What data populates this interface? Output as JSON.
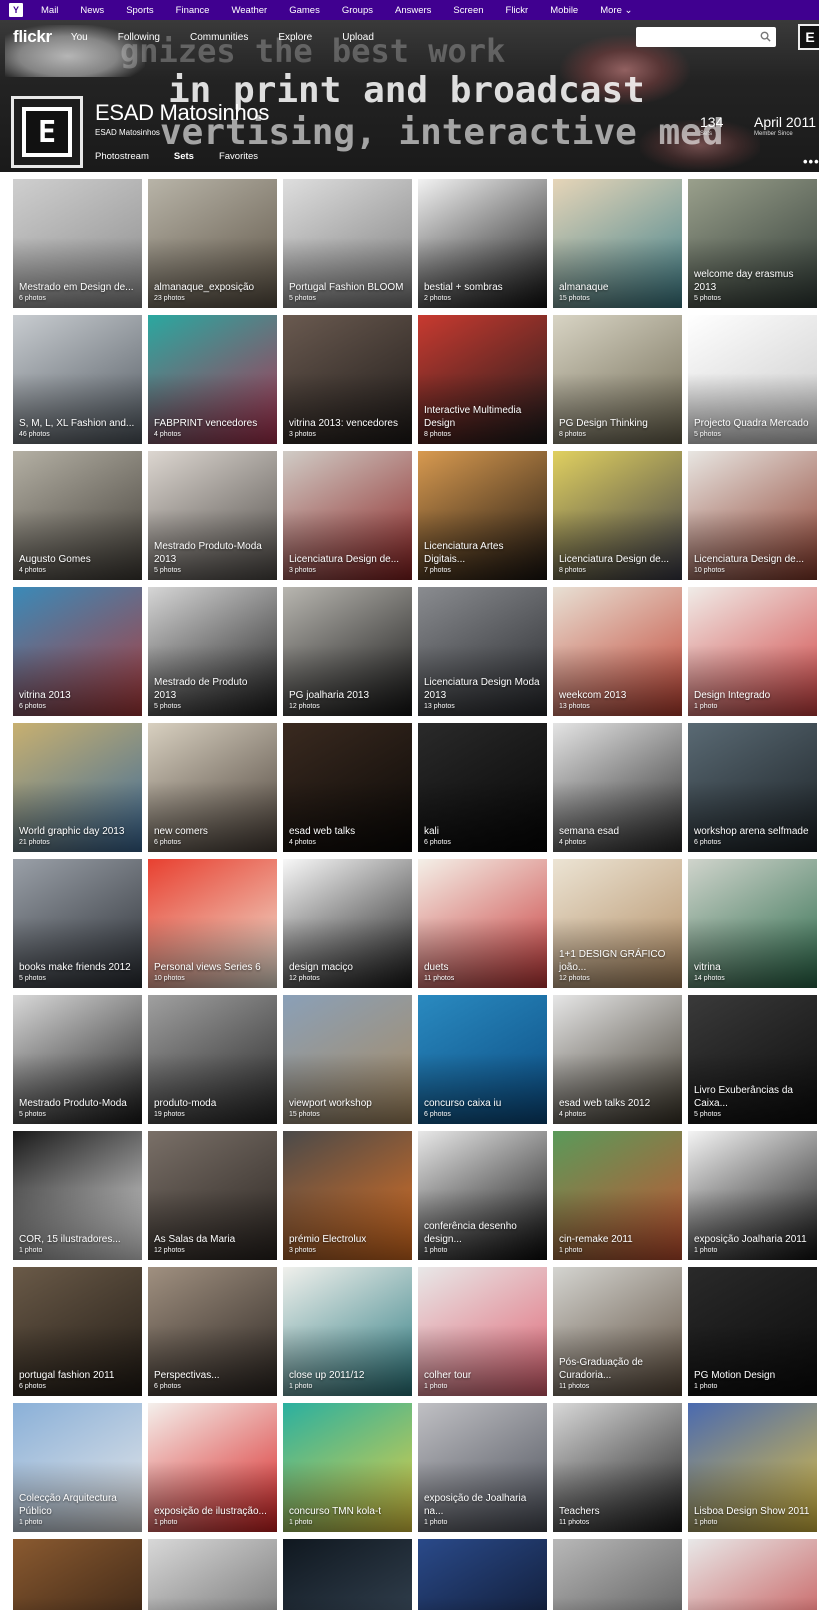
{
  "yahoo_bar": {
    "logo": "Y",
    "links": [
      "Mail",
      "News",
      "Sports",
      "Finance",
      "Weather",
      "Games",
      "Groups",
      "Answers",
      "Screen",
      "Flickr",
      "Mobile",
      "More ⌄"
    ]
  },
  "nav": {
    "logo": "flickr",
    "links": [
      "You",
      "Following",
      "Communities",
      "Explore",
      "Upload"
    ],
    "search_placeholder": "",
    "avatar_glyph": "E"
  },
  "banner": {
    "line1": "gnizes the best work",
    "line2": "in print and broadcast",
    "line3": "vertising, interactive med"
  },
  "profile": {
    "name": "ESAD Matosinhos",
    "subname": "ESAD Matosinhos",
    "avatar_glyph": "E",
    "sets_count": "134",
    "sets_label": "Sets",
    "member_since": "April 2011",
    "member_since_label": "Member Since"
  },
  "tabs": [
    "Photostream",
    "Sets",
    "Favorites"
  ],
  "active_tab": "Sets",
  "more_label": "•••",
  "sets": [
    {
      "title": "Mestrado em Design de...",
      "count": "6 photos",
      "bg": "#cfcfcf",
      "bg2": "#8a8a8a"
    },
    {
      "title": "almanaque_exposição",
      "count": "23 photos",
      "bg": "#b8b4a8",
      "bg2": "#5c5244"
    },
    {
      "title": "Portugal Fashion BLOOM",
      "count": "5 photos",
      "bg": "#dedede",
      "bg2": "#7a7a7a"
    },
    {
      "title": "bestial + sombras",
      "count": "2 photos",
      "bg": "#f2f2f2",
      "bg2": "#111111"
    },
    {
      "title": "almanaque",
      "count": "15 photos",
      "bg": "#e6d5b8",
      "bg2": "#3d7f8a"
    },
    {
      "title": "welcome day erasmus 2013",
      "count": "5 photos",
      "bg": "#9aa08c",
      "bg2": "#2f3a35"
    },
    {
      "title": "S, M, L, XL Fashion and...",
      "count": "46 photos",
      "bg": "#c8ccd0",
      "bg2": "#505860"
    },
    {
      "title": "FABPRINT vencedores",
      "count": "4 photos",
      "bg": "#2aa8a0",
      "bg2": "#b03050"
    },
    {
      "title": "vitrina 2013: vencedores",
      "count": "3 photos",
      "bg": "#6a5a50",
      "bg2": "#1e1a18"
    },
    {
      "title": "Interactive Multimedia Design",
      "count": "8 photos",
      "bg": "#c83a30",
      "bg2": "#1b1b1b"
    },
    {
      "title": "PG Design Thinking",
      "count": "8 photos",
      "bg": "#d8d4c4",
      "bg2": "#6c6650"
    },
    {
      "title": "Projecto Quadra Mercado",
      "count": "5 photos",
      "bg": "#ffffff",
      "bg2": "#c8c8c8"
    },
    {
      "title": "Augusto Gomes",
      "count": "4 photos",
      "bg": "#b4b0a4",
      "bg2": "#403c36"
    },
    {
      "title": "Mestrado Produto-Moda 2013",
      "count": "5 photos",
      "bg": "#dcd6d0",
      "bg2": "#4e4a46"
    },
    {
      "title": "Licenciatura Design de...",
      "count": "3 photos",
      "bg": "#d0ccc6",
      "bg2": "#8a2020"
    },
    {
      "title": "Licenciatura Artes Digitais...",
      "count": "7 photos",
      "bg": "#d89a50",
      "bg2": "#1a1410"
    },
    {
      "title": "Licenciatura Design de...",
      "count": "8 photos",
      "bg": "#e0d060",
      "bg2": "#3a3a48"
    },
    {
      "title": "Licenciatura Design de...",
      "count": "10 photos",
      "bg": "#e8e6e2",
      "bg2": "#8a3a2a"
    },
    {
      "title": "vitrina 2013",
      "count": "6 photos",
      "bg": "#3a8ab8",
      "bg2": "#b03a3a"
    },
    {
      "title": "Mestrado de Produto 2013",
      "count": "5 photos",
      "bg": "#d6d6d6",
      "bg2": "#1c1c1c"
    },
    {
      "title": "PG joalharia 2013",
      "count": "12 photos",
      "bg": "#b8b6b0",
      "bg2": "#141414"
    },
    {
      "title": "Licenciatura Design Moda 2013",
      "count": "13 photos",
      "bg": "#8a8c90",
      "bg2": "#26282c"
    },
    {
      "title": "weekcom 2013",
      "count": "13 photos",
      "bg": "#e8e0d4",
      "bg2": "#c04030"
    },
    {
      "title": "Design Integrado",
      "count": "1 photo",
      "bg": "#f0ece8",
      "bg2": "#d04040"
    },
    {
      "title": "World graphic day 2013",
      "count": "21 photos",
      "bg": "#c8b070",
      "bg2": "#3a6a9a"
    },
    {
      "title": "new comers",
      "count": "6 photos",
      "bg": "#d8d0c0",
      "bg2": "#4a4038"
    },
    {
      "title": "esad web talks",
      "count": "4 photos",
      "bg": "#3a2a20",
      "bg2": "#0a0806"
    },
    {
      "title": "kali",
      "count": "6 photos",
      "bg": "#2a2a2a",
      "bg2": "#050505"
    },
    {
      "title": "semana esad",
      "count": "4 photos",
      "bg": "#e4e4e4",
      "bg2": "#2a2a2a"
    },
    {
      "title": "workshop arena selfmade",
      "count": "6 photos",
      "bg": "#5a6a74",
      "bg2": "#1a2024"
    },
    {
      "title": "books make friends 2012",
      "count": "5 photos",
      "bg": "#9aa0a8",
      "bg2": "#2a2e34"
    },
    {
      "title": "Personal views Series 6",
      "count": "10 photos",
      "bg": "#e84030",
      "bg2": "#f0e8d8"
    },
    {
      "title": "design maciço",
      "count": "12 photos",
      "bg": "#f8f8f8",
      "bg2": "#1a1a1a"
    },
    {
      "title": "duets",
      "count": "11 photos",
      "bg": "#f4f0e8",
      "bg2": "#c83838"
    },
    {
      "title": "1+1 DESIGN GRÁFICO joão...",
      "count": "12 photos",
      "bg": "#ece4d4",
      "bg2": "#b08a60"
    },
    {
      "title": "vitrina",
      "count": "14 photos",
      "bg": "#d0d4cc",
      "bg2": "#2a6a4a"
    },
    {
      "title": "Mestrado Produto-Moda",
      "count": "5 photos",
      "bg": "#d8d8d8",
      "bg2": "#1a1a1a"
    },
    {
      "title": "produto-moda",
      "count": "19 photos",
      "bg": "#a0a0a0",
      "bg2": "#262626"
    },
    {
      "title": "viewport workshop",
      "count": "15 photos",
      "bg": "#8aa0b8",
      "bg2": "#a88a60"
    },
    {
      "title": "concurso caixa iu",
      "count": "6 photos",
      "bg": "#2a8ac0",
      "bg2": "#0a4a80"
    },
    {
      "title": "esad web talks 2012",
      "count": "4 photos",
      "bg": "#e6e6e6",
      "bg2": "#3a3428"
    },
    {
      "title": "Livro Exuberâncias da Caixa...",
      "count": "5 photos",
      "bg": "#3a3a3a",
      "bg2": "#0c0c0c"
    },
    {
      "title": "COR, 15 ilustradores...",
      "count": "1 photo",
      "bg": "#1a1a1a",
      "bg2": "#e8e8e8"
    },
    {
      "title": "As Salas da Maria",
      "count": "12 photos",
      "bg": "#7a7068",
      "bg2": "#2a2420"
    },
    {
      "title": "prémio Electrolux",
      "count": "3 photos",
      "bg": "#4a4a4a",
      "bg2": "#e07020"
    },
    {
      "title": "conferência desenho design...",
      "count": "1 photo",
      "bg": "#e8e8e8",
      "bg2": "#0a0a0a"
    },
    {
      "title": "cin-remake 2011",
      "count": "1 photo",
      "bg": "#5a9a5a",
      "bg2": "#c85030"
    },
    {
      "title": "exposição Joalharia 2011",
      "count": "1 photo",
      "bg": "#f4f4f4",
      "bg2": "#101010"
    },
    {
      "title": "portugal fashion 2011",
      "count": "6 photos",
      "bg": "#6a5a48",
      "bg2": "#201a14"
    },
    {
      "title": "Perspectivas...",
      "count": "6 photos",
      "bg": "#a09080",
      "bg2": "#2a2420"
    },
    {
      "title": "close up 2011/12",
      "count": "1 photo",
      "bg": "#f0f0ec",
      "bg2": "#2a7a80"
    },
    {
      "title": "colher tour",
      "count": "1 photo",
      "bg": "#e8e8e8",
      "bg2": "#e06070"
    },
    {
      "title": "Pós-Graduação de Curadoria...",
      "count": "11 photos",
      "bg": "#d4d4d0",
      "bg2": "#5a4a3a"
    },
    {
      "title": "PG Motion Design",
      "count": "1 photo",
      "bg": "#2a2a2a",
      "bg2": "#0a0a0a"
    },
    {
      "title": "Colecção Arquitectura Público",
      "count": "1 photo",
      "bg": "#8ab0d8",
      "bg2": "#e8e8e8"
    },
    {
      "title": "exposição de ilustração...",
      "count": "1 photo",
      "bg": "#f4f0ec",
      "bg2": "#d82020"
    },
    {
      "title": "concurso TMN kola-t",
      "count": "1 photo",
      "bg": "#2ab0a0",
      "bg2": "#e8d040"
    },
    {
      "title": "exposição de Joalharia na...",
      "count": "1 photo",
      "bg": "#c0c0c4",
      "bg2": "#4a4e58"
    },
    {
      "title": "Teachers",
      "count": "11 photos",
      "bg": "#d8d8d8",
      "bg2": "#1a1a1a"
    },
    {
      "title": "Lisboa Design Show 2011",
      "count": "1 photo",
      "bg": "#4a6ab0",
      "bg2": "#e0c040"
    },
    {
      "title": "",
      "count": "",
      "bg": "#8a5a30",
      "bg2": "#2a1a10"
    },
    {
      "title": "",
      "count": "",
      "bg": "#d8d8d8",
      "bg2": "#606060"
    },
    {
      "title": "",
      "count": "",
      "bg": "#101820",
      "bg2": "#3a4a5a"
    },
    {
      "title": "",
      "count": "",
      "bg": "#2a4a8a",
      "bg2": "#0a1020"
    },
    {
      "title": "",
      "count": "",
      "bg": "#b8b8b8",
      "bg2": "#4a4a4a"
    },
    {
      "title": "",
      "count": "",
      "bg": "#e8e8e8",
      "bg2": "#c04040"
    }
  ]
}
